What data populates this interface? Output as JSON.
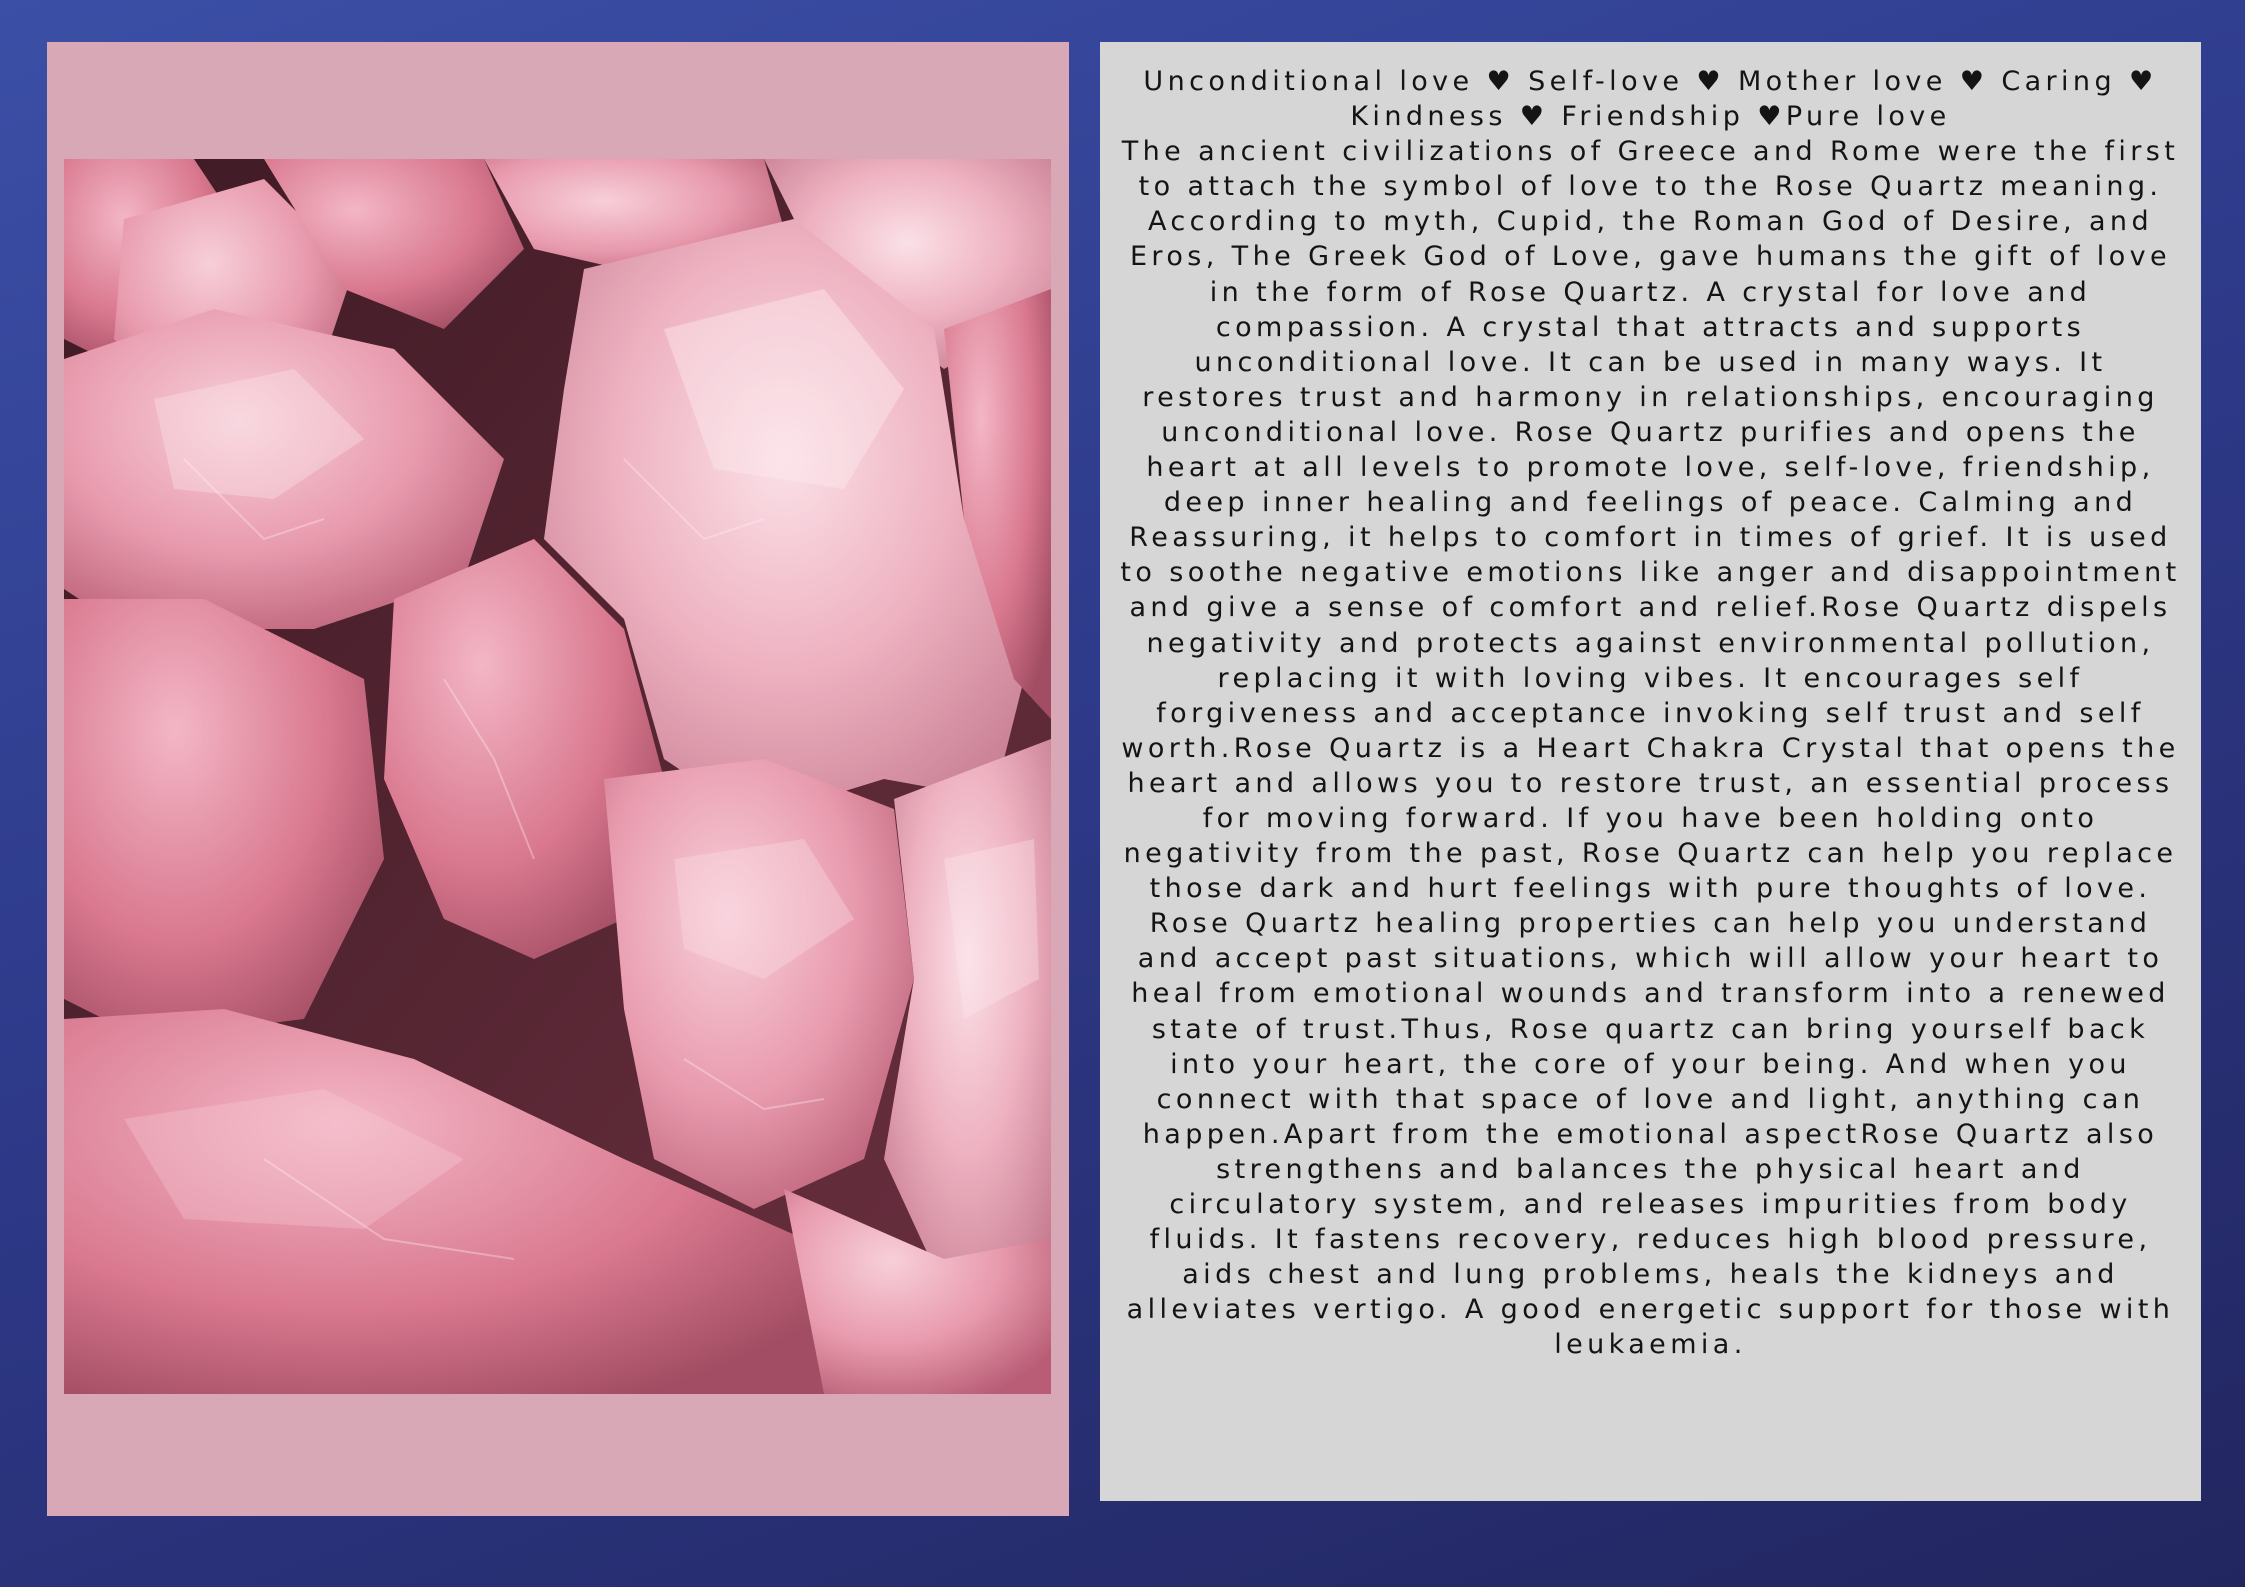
{
  "page": {
    "background_colors": [
      "#3b4fa6",
      "#222660"
    ],
    "left_panel_color": "#d8a8b6",
    "right_panel_color": "#d6d6d6",
    "text_color": "#141414"
  },
  "photo": {
    "subject": "rough-rose-quartz-crystals-photo",
    "palette": [
      "#e59aae",
      "#f4c6d2",
      "#c96b82",
      "#5a2a36"
    ]
  },
  "article": {
    "tagline": "Unconditional love ♥ Self-love ♥ Mother love ♥ Caring ♥ Kindness ♥ Friendship ♥Pure love",
    "body": "The ancient civilizations of Greece and Rome were the first to attach the symbol of love to the Rose Quartz meaning. According to myth, Cupid, the Roman God of Desire, and Eros, The Greek God of Love, gave humans the gift of love in the form of Rose Quartz. A crystal for love and compassion. A crystal that attracts and supports unconditional love. It can be used in many ways. It restores trust and harmony in relationships, encouraging unconditional love.  Rose Quartz purifies and opens the heart at all levels to promote love, self-love, friendship, deep inner healing and feelings of peace.  Calming and Reassuring, it helps to comfort in times of grief.  It is used to soothe negative emotions like anger and disappointment and give a sense of comfort and relief.Rose Quartz dispels negativity and protects against environmental pollution, replacing it with loving vibes.  It encourages self forgiveness and acceptance invoking self trust and self worth.Rose Quartz is a Heart Chakra Crystal that opens the heart and allows you to restore trust, an essential process for moving forward. If you have been holding onto negativity from the past, Rose Quartz can help you replace those dark and hurt feelings with pure thoughts of love. Rose Quartz healing properties can help you understand and accept past situations, which will allow your heart to heal from emotional wounds and transform into a renewed state of trust.Thus, Rose quartz can bring yourself back into your heart, the core of your being. And when you connect with that space of love and light, anything can happen.Apart from the emotional aspectRose Quartz also strengthens and balances the physical heart and circulatory system, and releases impurities from body fluids.  It fastens recovery, reduces high blood pressure, aids chest and lung problems, heals the kidneys and alleviates vertigo.  A good energetic support for those with leukaemia."
  }
}
